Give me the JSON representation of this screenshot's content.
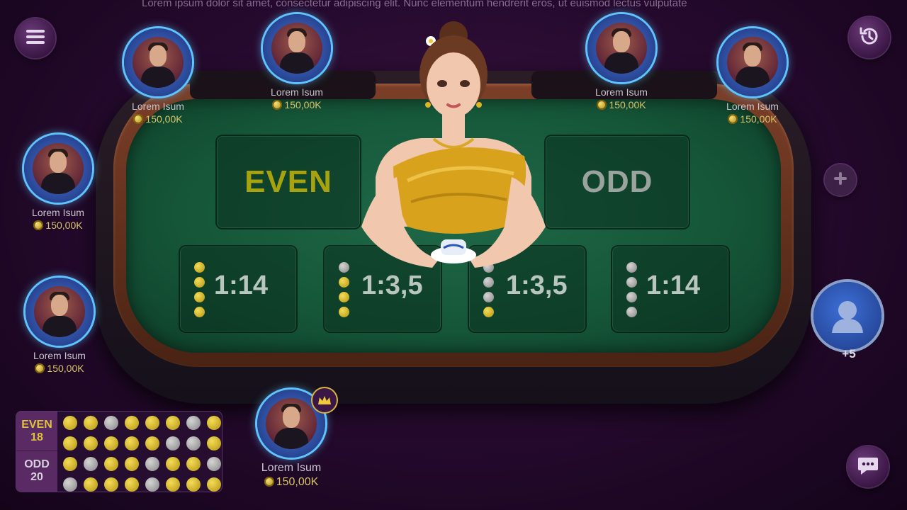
{
  "marquee": "Lorem ipsum dolor sit amet, consectetur adipiscing elit. Nunc elementum hendrerit eros, ut euismod lectus vulputate",
  "icons": {
    "menu": "menu-icon",
    "history": "history-icon",
    "add_seat": "plus-icon",
    "chat": "chat-icon",
    "crown": "crown-icon",
    "user": "user-icon"
  },
  "colors": {
    "even": "#aaa30f",
    "odd": "#9aa39e",
    "felt": "#155538"
  },
  "bets": {
    "even_label": "EVEN",
    "odd_label": "ODD",
    "odds": [
      {
        "label": "1:14",
        "dots": [
          "gold",
          "gold",
          "gold",
          "gold"
        ]
      },
      {
        "label": "1:3,5",
        "dots": [
          "grey",
          "gold",
          "gold",
          "gold"
        ]
      },
      {
        "label": "1:3,5",
        "dots": [
          "grey",
          "grey",
          "grey",
          "gold"
        ]
      },
      {
        "label": "1:14",
        "dots": [
          "grey",
          "grey",
          "grey",
          "grey"
        ]
      }
    ]
  },
  "players": [
    {
      "name": "Lorem Isum",
      "coins": "150,00K"
    },
    {
      "name": "Lorem Isum",
      "coins": "150,00K"
    },
    {
      "name": "Lorem Isum",
      "coins": "150,00K"
    },
    {
      "name": "Lorem Isum",
      "coins": "150,00K"
    },
    {
      "name": "Lorem Isum",
      "coins": "150,00K"
    },
    {
      "name": "Lorem Isum",
      "coins": "150,00K"
    },
    {
      "name": "Lorem Isum",
      "coins": "150,00K"
    }
  ],
  "spectators": "+5",
  "history": {
    "even_label": "EVEN",
    "even_count": "18",
    "odd_label": "ODD",
    "odd_count": "20",
    "grid": [
      [
        "gold",
        "gold",
        "grey",
        "gold",
        "gold",
        "gold",
        "grey",
        "gold"
      ],
      [
        "gold",
        "gold",
        "gold",
        "gold",
        "gold",
        "grey",
        "grey",
        "gold"
      ],
      [
        "gold",
        "grey",
        "gold",
        "gold",
        "grey",
        "gold",
        "gold",
        "grey"
      ],
      [
        "grey",
        "gold",
        "gold",
        "gold",
        "grey",
        "gold",
        "gold",
        "gold"
      ]
    ]
  }
}
